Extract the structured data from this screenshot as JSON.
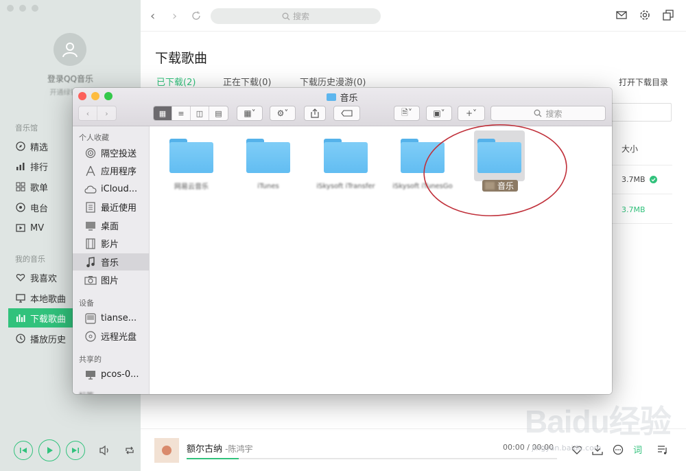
{
  "sidebar": {
    "login": "登录QQ音乐",
    "login_sub": "开通绿钻特权",
    "section_library": "音乐馆",
    "library_items": [
      {
        "label": "精选",
        "icon": "compass-icon"
      },
      {
        "label": "排行",
        "icon": "chart-icon"
      },
      {
        "label": "歌单",
        "icon": "grid-icon"
      },
      {
        "label": "电台",
        "icon": "radio-icon"
      },
      {
        "label": "MV",
        "icon": "play-box-icon"
      }
    ],
    "section_my": "我的音乐",
    "my_items": [
      {
        "label": "我喜欢",
        "icon": "heart-icon"
      },
      {
        "label": "本地歌曲",
        "icon": "monitor-icon"
      },
      {
        "label": "下载歌曲",
        "icon": "bars-icon",
        "active": true
      },
      {
        "label": "播放历史",
        "icon": "clock-icon"
      }
    ]
  },
  "topbar": {
    "search_placeholder": "搜索"
  },
  "page": {
    "title": "下载歌曲",
    "tabs": [
      {
        "label": "已下载(2)",
        "active": true
      },
      {
        "label": "正在下载(0)",
        "active": false
      },
      {
        "label": "下载历史漫游(0)",
        "active": false
      }
    ],
    "open_dir": "打开下载目录",
    "size_header": "大小",
    "rows": [
      {
        "size": "3.7MB",
        "downloaded": true
      },
      {
        "size": "3.7MB",
        "downloaded": false
      }
    ]
  },
  "player": {
    "song": "额尔古纳",
    "artist": "-陈鸿宇",
    "time": "00:00 / 00:00",
    "lyrics_label": "词",
    "progress": 0.14
  },
  "watermark": {
    "brand": "Baidu经验",
    "url": "jingyan.baidu.com"
  },
  "finder": {
    "title": "音乐",
    "search_placeholder": "搜索",
    "section_favorites": "个人收藏",
    "favorites": [
      {
        "label": "隔空投送",
        "icon": "airdrop-icon"
      },
      {
        "label": "应用程序",
        "icon": "apps-icon"
      },
      {
        "label": "iCloud...",
        "icon": "cloud-icon"
      },
      {
        "label": "最近使用",
        "icon": "recent-icon"
      },
      {
        "label": "桌面",
        "icon": "desktop-icon"
      },
      {
        "label": "影片",
        "icon": "film-icon"
      },
      {
        "label": "音乐",
        "icon": "music-note-icon",
        "selected": true
      },
      {
        "label": "图片",
        "icon": "camera-icon"
      }
    ],
    "section_devices": "设备",
    "devices": [
      {
        "label": "tianse...",
        "icon": "disk-icon"
      },
      {
        "label": "远程光盘",
        "icon": "optical-disc-icon"
      }
    ],
    "section_shared": "共享的",
    "shared": [
      {
        "label": "pcos-0...",
        "icon": "computer-icon"
      }
    ],
    "section_tags": "标签",
    "folders": [
      {
        "label": "网易云音乐"
      },
      {
        "label": "iTunes"
      },
      {
        "label": "iSkysoft iTransfer"
      },
      {
        "label": "iSkysoft iTunesGo"
      },
      {
        "label": "音乐",
        "selected": true
      }
    ]
  },
  "colors": {
    "accent": "#31c27c",
    "annotation": "#c0303a",
    "folder": "#6cc3f4"
  }
}
